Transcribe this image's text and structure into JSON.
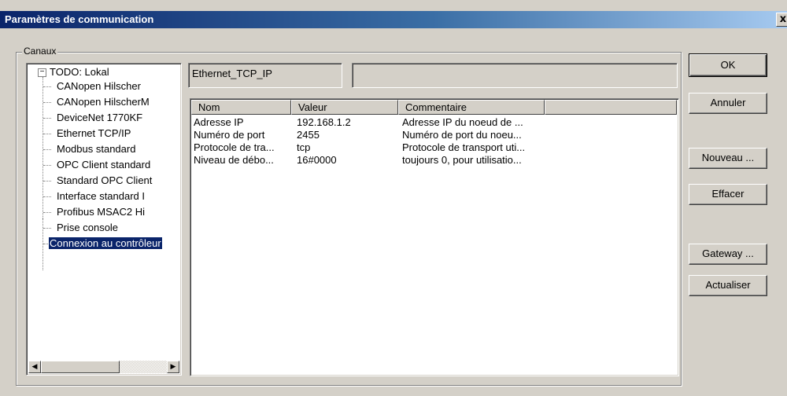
{
  "window": {
    "title": "Paramètres de communication",
    "close_label": "x"
  },
  "channels": {
    "group_label": "Canaux",
    "tree": {
      "root": "TODO: Lokal",
      "children": [
        "CANopen Hilscher",
        "CANopen HilscherM",
        "DeviceNet 1770KF",
        "Ethernet TCP/IP",
        "Modbus standard",
        "OPC Client standard",
        "Standard OPC Client",
        "Interface standard I",
        "Profibus MSAC2 Hi",
        "Prise console"
      ],
      "selected": "Connexion au contrôleur"
    }
  },
  "connection": {
    "name": "Ethernet_TCP_IP",
    "info": ""
  },
  "params_table": {
    "columns": [
      "Nom",
      "Valeur",
      "Commentaire"
    ],
    "rows": [
      [
        "Adresse IP",
        "192.168.1.2",
        "Adresse IP du noeud de ..."
      ],
      [
        "Numéro de port",
        "2455",
        "Numéro de port du noeu..."
      ],
      [
        "Protocole de tra...",
        "tcp",
        "Protocole de transport uti..."
      ],
      [
        "Niveau de débo...",
        "16#0000",
        "toujours 0, pour utilisatio..."
      ]
    ]
  },
  "buttons": {
    "ok": "OK",
    "cancel": "Annuler",
    "new": "Nouveau ...",
    "delete": "Effacer",
    "gateway": "Gateway ...",
    "refresh": "Actualiser"
  }
}
